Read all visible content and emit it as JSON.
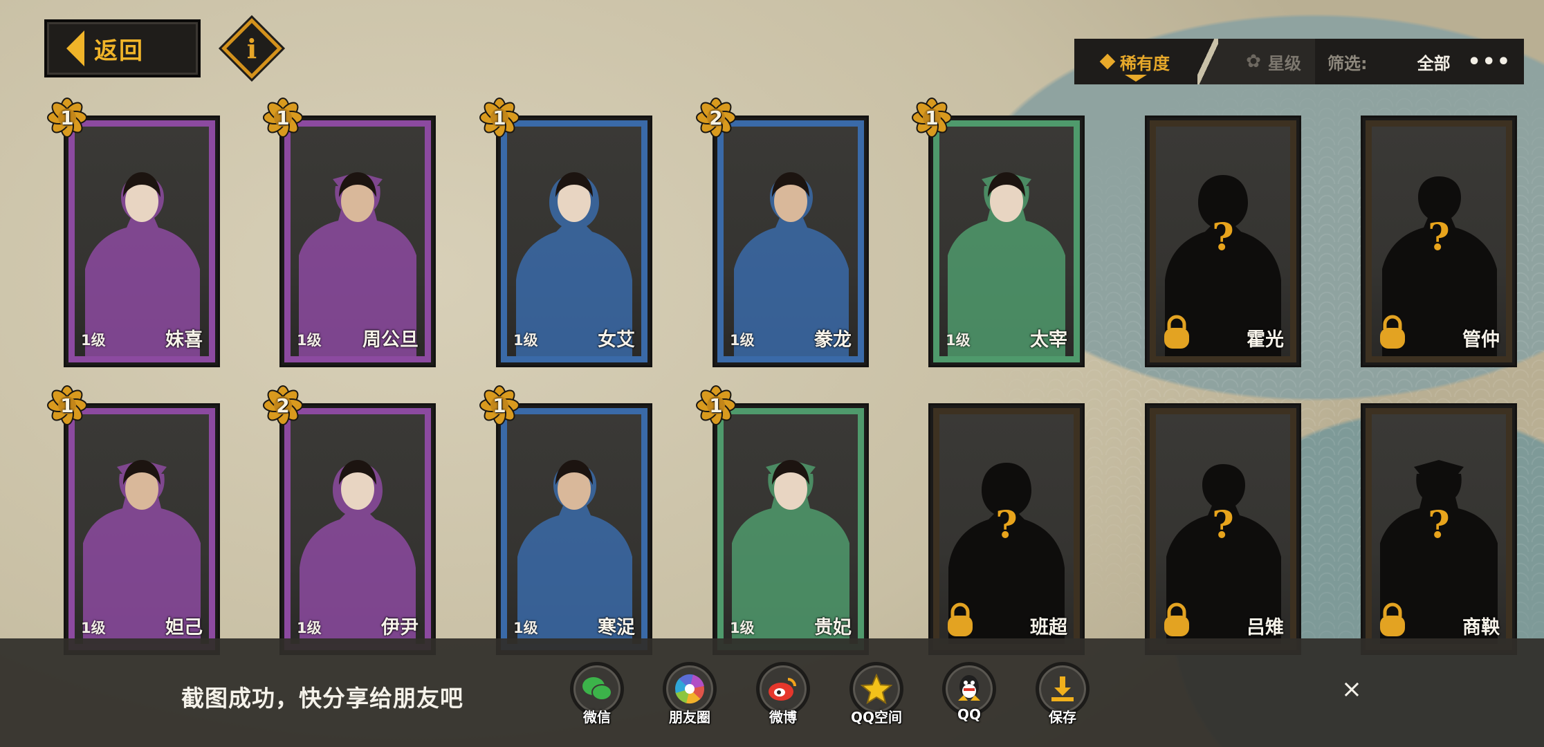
{
  "header": {
    "back_label": "返回",
    "info_icon": "info-icon"
  },
  "sort": {
    "rarity_label": "稀有度",
    "star_label": "星级",
    "active": "rarity"
  },
  "filter": {
    "label": "筛选:",
    "value": "全部",
    "more": "•••"
  },
  "cards": [
    {
      "star": "1",
      "level": "1级",
      "name": "妹喜",
      "rarity_color": "#8c4aa0",
      "locked": false
    },
    {
      "star": "1",
      "level": "1级",
      "name": "周公旦",
      "rarity_color": "#8c4aa0",
      "locked": false
    },
    {
      "star": "1",
      "level": "1级",
      "name": "女艾",
      "rarity_color": "#3a6aa8",
      "locked": false
    },
    {
      "star": "2",
      "level": "1级",
      "name": "豢龙",
      "rarity_color": "#3a6aa8",
      "locked": false
    },
    {
      "star": "1",
      "level": "1级",
      "name": "太宰",
      "rarity_color": "#4f9a6c",
      "locked": false
    },
    {
      "star": "",
      "level": "",
      "name": "霍光",
      "rarity_color": "#3d3121",
      "locked": true
    },
    {
      "star": "",
      "level": "",
      "name": "管仲",
      "rarity_color": "#3d3121",
      "locked": true
    },
    {
      "star": "1",
      "level": "1级",
      "name": "妲己",
      "rarity_color": "#8c4aa0",
      "locked": false
    },
    {
      "star": "2",
      "level": "1级",
      "name": "伊尹",
      "rarity_color": "#8c4aa0",
      "locked": false
    },
    {
      "star": "1",
      "level": "1级",
      "name": "寒浞",
      "rarity_color": "#3a6aa8",
      "locked": false
    },
    {
      "star": "1",
      "level": "1级",
      "name": "贵妃",
      "rarity_color": "#4f9a6c",
      "locked": false
    },
    {
      "star": "",
      "level": "",
      "name": "班超",
      "rarity_color": "#3d3121",
      "locked": true
    },
    {
      "star": "",
      "level": "",
      "name": "吕雉",
      "rarity_color": "#3d3121",
      "locked": true
    },
    {
      "star": "",
      "level": "",
      "name": "商鞅",
      "rarity_color": "#3d3121",
      "locked": true
    }
  ],
  "share": {
    "message": "截图成功，快分享给朋友吧",
    "targets": [
      {
        "label": "微信",
        "icon": "wechat-icon",
        "color": "#3cb34a"
      },
      {
        "label": "朋友圈",
        "icon": "moments-icon",
        "color": "#e0554a"
      },
      {
        "label": "微博",
        "icon": "weibo-icon",
        "color": "#e6372c"
      },
      {
        "label": "QQ空间",
        "icon": "qzone-icon",
        "color": "#f3c21a"
      },
      {
        "label": "QQ",
        "icon": "qq-icon",
        "color": "#1f1f1f"
      },
      {
        "label": "保存",
        "icon": "download-icon",
        "color": "#f1b01c"
      }
    ],
    "close": "×"
  }
}
